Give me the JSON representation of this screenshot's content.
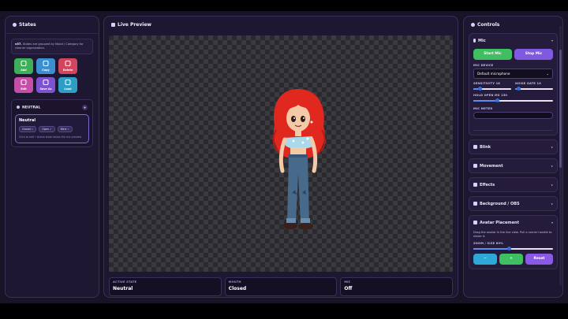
{
  "states_panel": {
    "title": "States",
    "info_bold": "v57.",
    "info_text": "States are grouped by Mood / Category for cleaner organization.",
    "buttons": [
      {
        "label": "Add",
        "icon": "plus-icon"
      },
      {
        "label": "Copy",
        "icon": "copy-icon"
      },
      {
        "label": "Delete",
        "icon": "trash-icon"
      },
      {
        "label": "Edit",
        "icon": "edit-icon"
      },
      {
        "label": "Save As",
        "icon": "save-icon"
      },
      {
        "label": "Load",
        "icon": "folder-icon"
      }
    ],
    "group_title": "NEUTRAL",
    "state": {
      "name": "Neutral",
      "chips": [
        "Closed ✓",
        "Open ✓",
        "Blink ✓"
      ],
      "hint": "Click to edit • Active state drives the mic preview"
    }
  },
  "preview": {
    "title": "Live Preview",
    "stats": [
      {
        "label": "ACTIVE STATE",
        "value": "Neutral"
      },
      {
        "label": "MOUTH",
        "value": "Closed"
      },
      {
        "label": "MIC",
        "value": "Off"
      }
    ]
  },
  "controls": {
    "title": "Controls",
    "mic": {
      "title": "Mic",
      "start_label": "Start Mic",
      "stop_label": "Stop Mic",
      "device_label": "MIC DEVICE",
      "device_value": "Default microphone",
      "sensitivity_label": "SENSITIVITY 18",
      "sensitivity": 0.18,
      "noise_gate_label": "NOISE GATE 10",
      "noise_gate": 0.1,
      "hold_label": "HOLD OPEN MS 150",
      "hold": 0.3,
      "meter_label": "MIC METER"
    },
    "sections": [
      "Blink",
      "Movement",
      "Effects",
      "Background / OBS"
    ],
    "placement": {
      "title": "Avatar Placement",
      "desc": "Drag the avatar in the live view. Pull a corner handle to resize it.",
      "zoom_label": "ZOOM / SIZE 89%",
      "zoom": 0.45,
      "minus": "−",
      "plus": "+",
      "reset": "Reset"
    }
  }
}
